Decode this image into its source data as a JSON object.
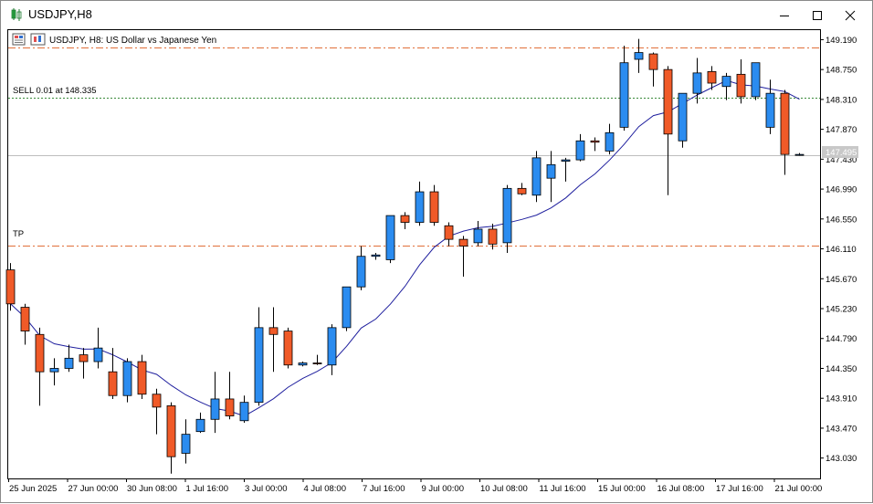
{
  "window": {
    "title": "USDJPY,H8",
    "minimize_icon": "minimize-icon",
    "maximize_icon": "maximize-icon",
    "close_icon": "close-icon"
  },
  "chart": {
    "header_text": "USDJPY, H8:  US Dollar vs Japanese Yen",
    "sell_label": "SELL 0.01 at 148.335",
    "tp_label": "TP",
    "current_price_label": "147.495"
  },
  "chart_data": {
    "type": "candlestick",
    "symbol": "USDJPY",
    "timeframe": "H8",
    "yticks": [
      "149.190",
      "148.750",
      "148.310",
      "147.870",
      "147.430",
      "146.990",
      "146.550",
      "146.110",
      "145.670",
      "145.230",
      "144.790",
      "144.350",
      "143.910",
      "143.470",
      "143.030"
    ],
    "xticks": [
      "25 Jun 2025",
      "27 Jun 00:00",
      "30 Jun 08:00",
      "1 Jul 16:00",
      "3 Jul 00:00",
      "4 Jul 08:00",
      "7 Jul 16:00",
      "9 Jul 00:00",
      "10 Jul 08:00",
      "11 Jul 16:00",
      "15 Jul 00:00",
      "16 Jul 08:00",
      "17 Jul 16:00",
      "21 Jul 00:00"
    ],
    "ylim": [
      142.73,
      149.33
    ],
    "horizontal_lines": [
      {
        "name": "upper-level",
        "value": 149.08,
        "style": "dash-dot",
        "color": "#e0703a"
      },
      {
        "name": "sell-entry",
        "value": 148.335,
        "style": "dotted",
        "color": "#3a8a3a"
      },
      {
        "name": "current-price",
        "value": 147.495,
        "style": "solid",
        "color": "#bdbdbd"
      },
      {
        "name": "take-profit",
        "value": 146.16,
        "style": "dash-dot",
        "color": "#e0703a"
      }
    ],
    "colors": {
      "bull": "#2b8cf0",
      "bear": "#f05a28",
      "wick": "#000000",
      "ma": "#1f1f9e",
      "grid_bg": "#ffffff"
    },
    "candles": [
      {
        "o": 145.8,
        "h": 145.9,
        "l": 145.2,
        "c": 145.3
      },
      {
        "o": 145.25,
        "h": 145.3,
        "l": 144.7,
        "c": 144.9
      },
      {
        "o": 144.85,
        "h": 144.95,
        "l": 143.8,
        "c": 144.3
      },
      {
        "o": 144.3,
        "h": 144.5,
        "l": 144.1,
        "c": 144.35
      },
      {
        "o": 144.35,
        "h": 144.7,
        "l": 144.3,
        "c": 144.5
      },
      {
        "o": 144.55,
        "h": 144.65,
        "l": 144.2,
        "c": 144.45
      },
      {
        "o": 144.45,
        "h": 144.95,
        "l": 144.35,
        "c": 144.65
      },
      {
        "o": 144.3,
        "h": 144.65,
        "l": 143.9,
        "c": 143.95
      },
      {
        "o": 143.95,
        "h": 144.5,
        "l": 143.85,
        "c": 144.45
      },
      {
        "o": 144.45,
        "h": 144.55,
        "l": 143.9,
        "c": 143.97
      },
      {
        "o": 143.97,
        "h": 144.05,
        "l": 143.38,
        "c": 143.78
      },
      {
        "o": 143.8,
        "h": 143.85,
        "l": 142.8,
        "c": 143.05
      },
      {
        "o": 143.1,
        "h": 143.6,
        "l": 142.95,
        "c": 143.38
      },
      {
        "o": 143.42,
        "h": 143.7,
        "l": 143.4,
        "c": 143.6
      },
      {
        "o": 143.6,
        "h": 144.3,
        "l": 143.4,
        "c": 143.9
      },
      {
        "o": 143.9,
        "h": 144.3,
        "l": 143.6,
        "c": 143.65
      },
      {
        "o": 143.58,
        "h": 143.95,
        "l": 143.55,
        "c": 143.85
      },
      {
        "o": 143.85,
        "h": 145.25,
        "l": 143.8,
        "c": 144.95
      },
      {
        "o": 144.95,
        "h": 145.25,
        "l": 144.3,
        "c": 144.85
      },
      {
        "o": 144.9,
        "h": 144.95,
        "l": 144.35,
        "c": 144.4
      },
      {
        "o": 144.4,
        "h": 144.45,
        "l": 144.38,
        "c": 144.43
      },
      {
        "o": 144.43,
        "h": 144.55,
        "l": 144.4,
        "c": 144.42
      },
      {
        "o": 144.4,
        "h": 145.0,
        "l": 144.25,
        "c": 144.95
      },
      {
        "o": 144.95,
        "h": 145.55,
        "l": 144.9,
        "c": 145.55
      },
      {
        "o": 145.55,
        "h": 146.15,
        "l": 145.5,
        "c": 146.0
      },
      {
        "o": 146.0,
        "h": 146.05,
        "l": 145.95,
        "c": 146.02
      },
      {
        "o": 145.95,
        "h": 146.5,
        "l": 145.9,
        "c": 146.6
      },
      {
        "o": 146.6,
        "h": 146.65,
        "l": 146.4,
        "c": 146.5
      },
      {
        "o": 146.5,
        "h": 147.1,
        "l": 146.45,
        "c": 146.95
      },
      {
        "o": 146.95,
        "h": 147.05,
        "l": 146.45,
        "c": 146.5
      },
      {
        "o": 146.45,
        "h": 146.5,
        "l": 146.15,
        "c": 146.25
      },
      {
        "o": 146.25,
        "h": 146.3,
        "l": 145.7,
        "c": 146.15
      },
      {
        "o": 146.2,
        "h": 146.52,
        "l": 146.15,
        "c": 146.4
      },
      {
        "o": 146.4,
        "h": 146.48,
        "l": 146.1,
        "c": 146.18
      },
      {
        "o": 146.2,
        "h": 147.05,
        "l": 146.05,
        "c": 147.0
      },
      {
        "o": 147.0,
        "h": 147.08,
        "l": 146.9,
        "c": 146.92
      },
      {
        "o": 146.9,
        "h": 147.55,
        "l": 146.8,
        "c": 147.45
      },
      {
        "o": 147.15,
        "h": 147.55,
        "l": 146.8,
        "c": 147.35
      },
      {
        "o": 147.4,
        "h": 147.45,
        "l": 147.1,
        "c": 147.42
      },
      {
        "o": 147.42,
        "h": 147.8,
        "l": 147.4,
        "c": 147.7
      },
      {
        "o": 147.7,
        "h": 147.75,
        "l": 147.55,
        "c": 147.68
      },
      {
        "o": 147.55,
        "h": 147.95,
        "l": 147.5,
        "c": 147.82
      },
      {
        "o": 147.9,
        "h": 149.1,
        "l": 147.85,
        "c": 148.85
      },
      {
        "o": 148.9,
        "h": 149.2,
        "l": 148.7,
        "c": 149.0
      },
      {
        "o": 148.98,
        "h": 149.0,
        "l": 148.5,
        "c": 148.75
      },
      {
        "o": 148.75,
        "h": 148.8,
        "l": 146.9,
        "c": 147.8
      },
      {
        "o": 147.7,
        "h": 148.4,
        "l": 147.6,
        "c": 148.4
      },
      {
        "o": 148.4,
        "h": 148.92,
        "l": 148.25,
        "c": 148.7
      },
      {
        "o": 148.72,
        "h": 148.8,
        "l": 148.45,
        "c": 148.55
      },
      {
        "o": 148.5,
        "h": 148.7,
        "l": 148.3,
        "c": 148.65
      },
      {
        "o": 148.68,
        "h": 148.9,
        "l": 148.25,
        "c": 148.35
      },
      {
        "o": 148.35,
        "h": 148.85,
        "l": 148.3,
        "c": 148.85
      },
      {
        "o": 147.9,
        "h": 148.6,
        "l": 147.8,
        "c": 148.4
      },
      {
        "o": 148.4,
        "h": 148.45,
        "l": 147.2,
        "c": 147.5
      },
      {
        "o": 147.5,
        "h": 147.52,
        "l": 147.48,
        "c": 147.5
      }
    ]
  }
}
